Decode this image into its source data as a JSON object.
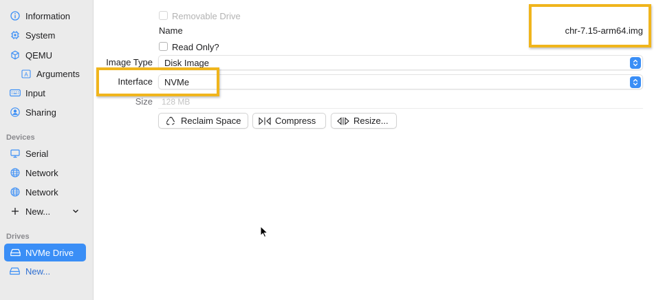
{
  "sidebar": {
    "items": [
      {
        "label": "Information",
        "icon": "info-icon"
      },
      {
        "label": "System",
        "icon": "chip-icon"
      },
      {
        "label": "QEMU",
        "icon": "cube-icon"
      },
      {
        "label": "Arguments",
        "icon": "text-a-icon"
      },
      {
        "label": "Input",
        "icon": "keyboard-icon"
      },
      {
        "label": "Sharing",
        "icon": "person-icon"
      }
    ],
    "devices_header": "Devices",
    "devices": [
      {
        "label": "Serial",
        "icon": "display-icon"
      },
      {
        "label": "Network",
        "icon": "globe-icon"
      },
      {
        "label": "Network",
        "icon": "globe-icon"
      }
    ],
    "new_device_label": "New...",
    "drives_header": "Drives",
    "drives": [
      {
        "label": "NVMe Drive",
        "icon": "drive-icon",
        "selected": true
      }
    ],
    "new_drive_label": "New...",
    "accent": "#3a8ef6"
  },
  "form": {
    "removable_drive_label": "Removable Drive",
    "name_label": "Name",
    "name_value": "chr-7.15-arm64.img",
    "read_only_label": "Read Only?",
    "image_type_label": "Image Type",
    "image_type_value": "Disk Image",
    "interface_label": "Interface",
    "interface_value": "NVMe",
    "size_label": "Size",
    "size_placeholder": "128 MB"
  },
  "buttons": {
    "reclaim": "Reclaim Space",
    "compress": "Compress",
    "resize": "Resize..."
  },
  "highlight_color": "#f0b51c"
}
